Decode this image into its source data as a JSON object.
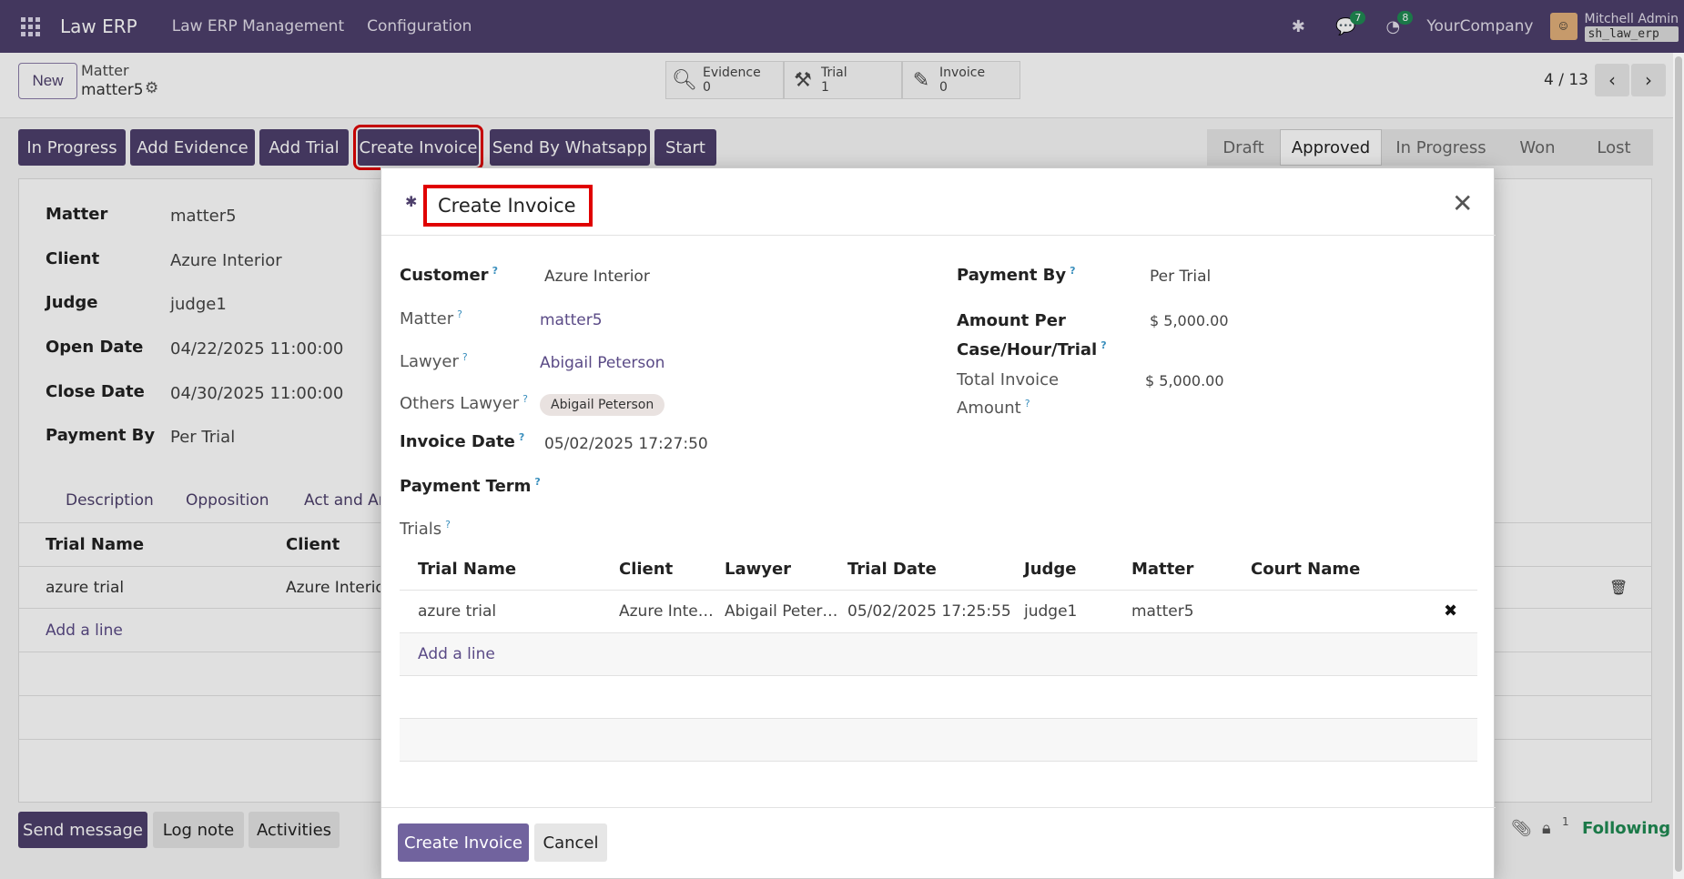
{
  "navbar": {
    "brand": "Law ERP",
    "menu": [
      "Law ERP Management",
      "Configuration"
    ],
    "chat_count": "7",
    "activity_count": "8",
    "company": "YourCompany",
    "user_name": "Mitchell Admin",
    "database": "sh_law_erp"
  },
  "control": {
    "new_label": "New",
    "breadcrumb_parent": "Matter",
    "record_name": "matter5",
    "smart_buttons": [
      {
        "label": "Evidence",
        "count": "0",
        "icon": "search-zoom-icon"
      },
      {
        "label": "Trial",
        "count": "1",
        "icon": "gavel-icon"
      },
      {
        "label": "Invoice",
        "count": "0",
        "icon": "edit-invoice-icon"
      }
    ],
    "pager": "4 / 13"
  },
  "header_buttons": [
    "In Progress",
    "Add Evidence",
    "Add Trial",
    "Create Invoice",
    "Send By Whatsapp",
    "Start"
  ],
  "statusbar": [
    "Draft",
    "Approved",
    "In Progress",
    "Won",
    "Lost"
  ],
  "statusbar_active": "Approved",
  "form": {
    "fields": [
      {
        "label": "Matter",
        "value": "matter5"
      },
      {
        "label": "Client",
        "value": "Azure Interior"
      },
      {
        "label": "Judge",
        "value": "judge1"
      },
      {
        "label": "Open Date",
        "value": "04/22/2025 11:00:00"
      },
      {
        "label": "Close Date",
        "value": "04/30/2025 11:00:00"
      },
      {
        "label": "Payment By",
        "value": "Per Trial"
      }
    ],
    "tabs": [
      "Description",
      "Opposition",
      "Act and Ar"
    ],
    "table_headers": [
      "Trial Name",
      "Client"
    ],
    "table_row": [
      "azure trial",
      "Azure Interio"
    ],
    "add_line": "Add a line"
  },
  "chatter": {
    "send_message": "Send message",
    "log_note": "Log note",
    "activities": "Activities",
    "followers_count": "1",
    "following": "Following"
  },
  "modal": {
    "title": "Create Invoice",
    "customer_label": "Customer",
    "customer": "Azure Interior",
    "matter_label": "Matter",
    "matter": "matter5",
    "lawyer_label": "Lawyer",
    "lawyer": "Abigail Peterson",
    "others_lawyer_label": "Others Lawyer",
    "others_lawyer_tag": "Abigail Peterson",
    "invoice_date_label": "Invoice Date",
    "invoice_date": "05/02/2025 17:27:50",
    "payment_term_label": "Payment Term",
    "trials_label": "Trials",
    "payment_by_label": "Payment By",
    "payment_by": "Per Trial",
    "amount_label_1": "Amount Per",
    "amount_label_2": "Case/Hour/Trial",
    "amount": "$ 5,000.00",
    "total_label_1": "Total Invoice",
    "total_label_2": "Amount",
    "total": "$ 5,000.00",
    "trials_headers": [
      "Trial Name",
      "Client",
      "Lawyer",
      "Trial Date",
      "Judge",
      "Matter",
      "Court Name"
    ],
    "trials_rows": [
      [
        "azure trial",
        "Azure Inte…",
        "Abigail Peter…",
        "05/02/2025 17:25:55",
        "judge1",
        "matter5",
        ""
      ]
    ],
    "add_line": "Add a line",
    "create_button": "Create Invoice",
    "cancel_button": "Cancel"
  }
}
